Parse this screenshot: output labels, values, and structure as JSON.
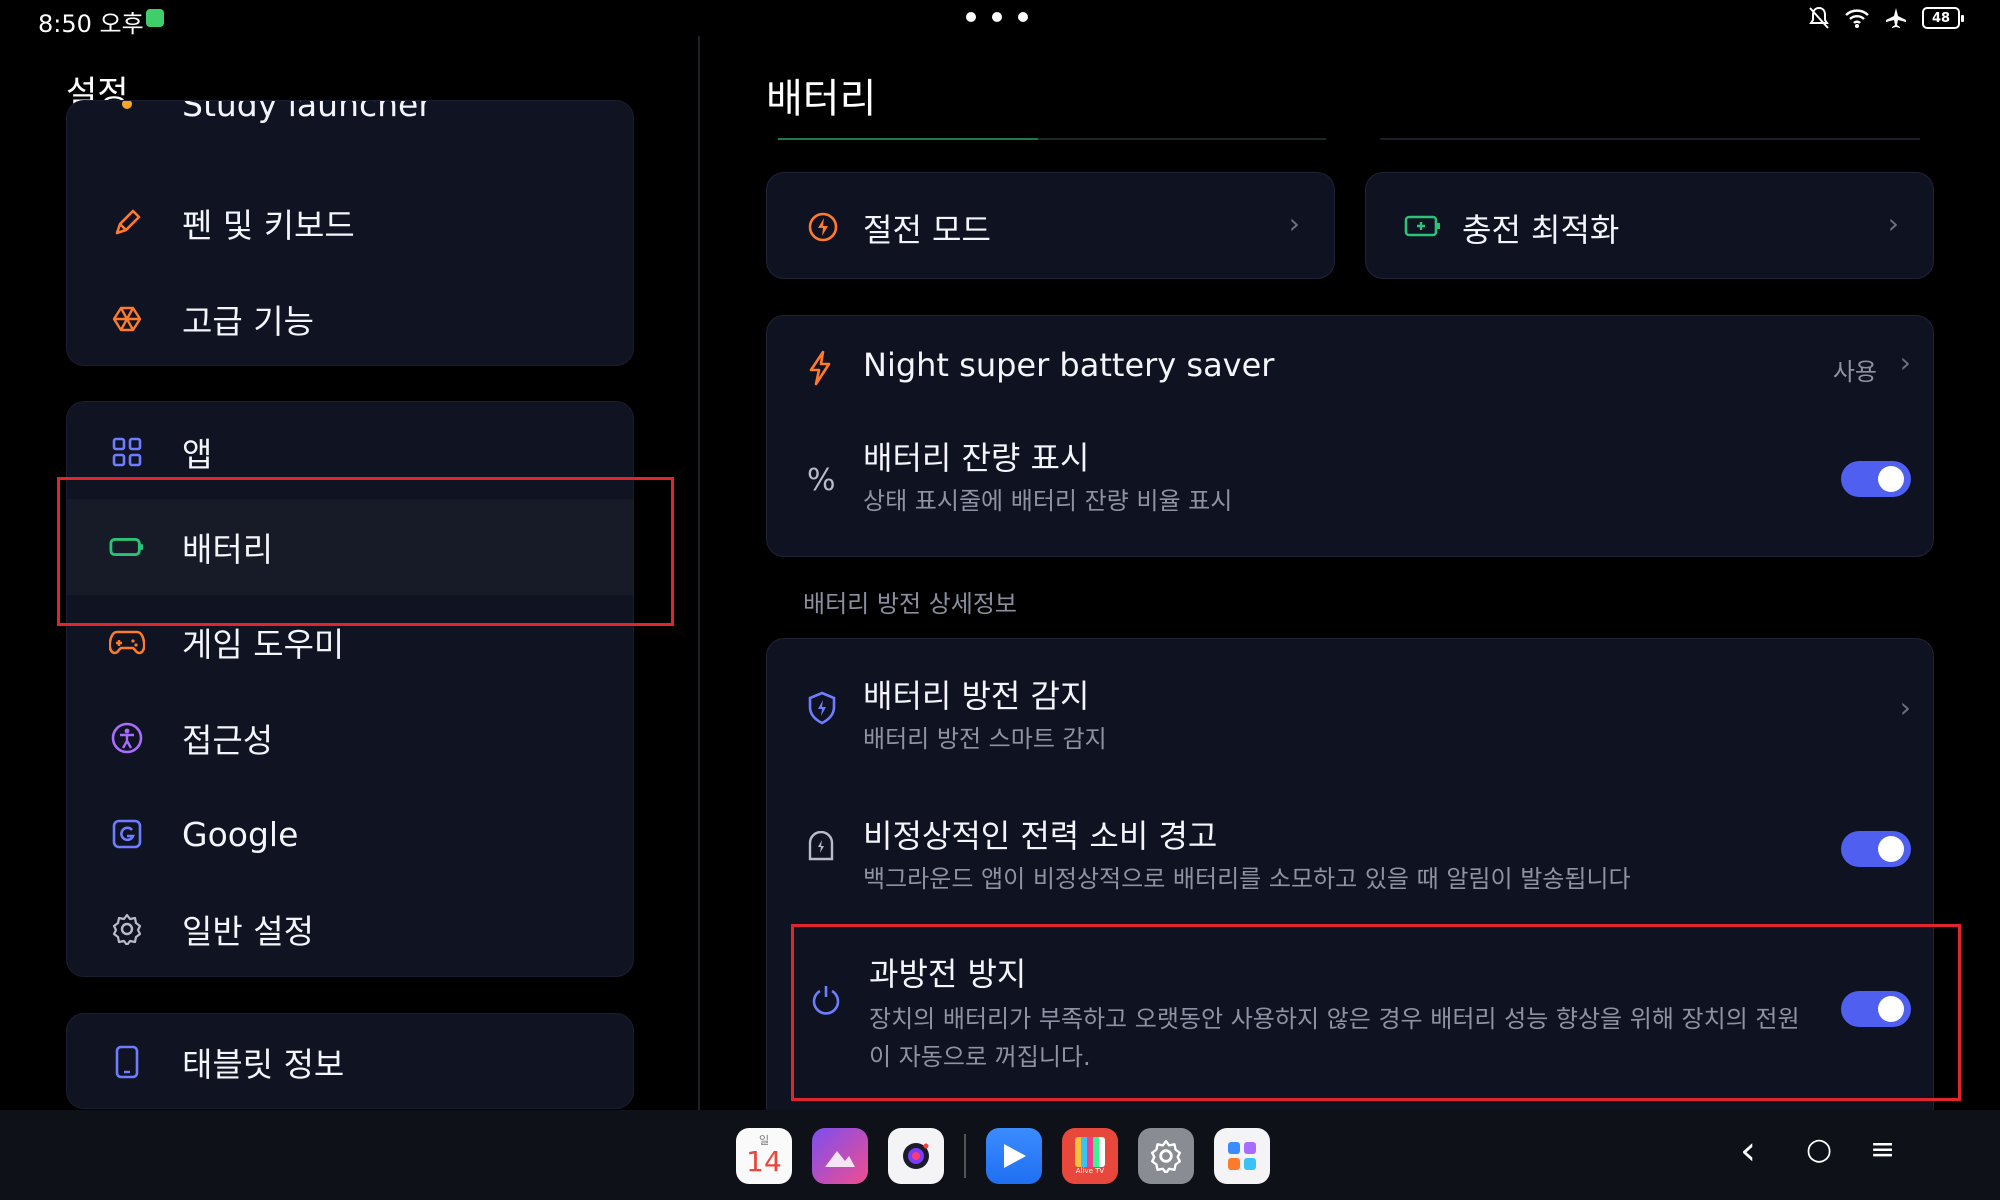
{
  "status_bar": {
    "time": "8:50 오후",
    "battery": "48"
  },
  "left_pane": {
    "title": "설정",
    "partial_item": "Study launcher",
    "group1": [
      {
        "label": "펜 및 키보드",
        "icon": "pen-icon"
      },
      {
        "label": "고급 기능",
        "icon": "advanced-features-icon"
      }
    ],
    "group2": [
      {
        "label": "앱",
        "icon": "apps-grid-icon"
      },
      {
        "label": "배터리",
        "icon": "battery-icon",
        "active": true
      },
      {
        "label": "게임 도우미",
        "icon": "gamepad-icon"
      },
      {
        "label": "접근성",
        "icon": "accessibility-icon"
      },
      {
        "label": "Google",
        "icon": "google-icon"
      },
      {
        "label": "일반 설정",
        "icon": "gear-icon"
      }
    ],
    "group3": [
      {
        "label": "태블릿 정보",
        "icon": "tablet-icon"
      }
    ]
  },
  "right_pane": {
    "title": "배터리",
    "tiles": [
      {
        "label": "절전 모드",
        "icon": "power-saving-icon"
      },
      {
        "label": "충전 최적화",
        "icon": "charging-icon"
      }
    ],
    "night_saver": {
      "label": "Night super battery saver",
      "value": "사용"
    },
    "battery_percentage": {
      "title": "배터리 잔량 표시",
      "subtitle": "상태 표시줄에 배터리 잔량 비율 표시",
      "enabled": true
    },
    "section_label": "배터리 방전 상세정보",
    "drain_detection": {
      "title": "배터리 방전 감지",
      "subtitle": "배터리 방전 스마트 감지"
    },
    "abnormal_power": {
      "title": "비정상적인 전력 소비 경고",
      "subtitle": "백그라운드 앱이 비정상적으로 배터리를 소모하고 있을 때 알림이 발송됩니다",
      "enabled": true
    },
    "overdischarge": {
      "title": "과방전 방지",
      "subtitle_line1": "장치의 배터리가 부족하고 오랫동안 사용하지 않은 경우 배터리 성능 향상을 위해 장치의 전원",
      "subtitle_line2": "이 자동으로 꺼집니다.",
      "enabled": true
    }
  },
  "taskbar": {
    "calendar_day_label": "일",
    "calendar_date": "14",
    "alive_tv_label": "Alive TV",
    "nav": {
      "back": "‹",
      "home": "○",
      "menu": "≡"
    }
  },
  "colors": {
    "accent": "#4f5ff0",
    "highlight": "#e0262b",
    "battery_green": "#2bc27a",
    "orange": "#ff7a2b"
  }
}
